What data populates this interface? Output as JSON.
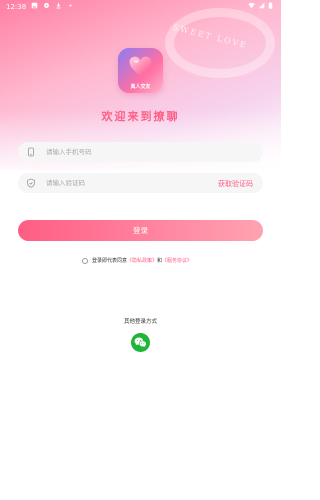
{
  "status_bar": {
    "time": "12:38",
    "left_icons": [
      "gallery-icon",
      "settings-icon",
      "download-icon",
      "dot-icon"
    ],
    "right_icons": [
      "wifi-icon",
      "signal-icon",
      "battery-icon"
    ]
  },
  "header": {
    "decor_text": "SWEET LOVE",
    "app_logo_label": "真人交友",
    "welcome": "欢迎来到撩聊"
  },
  "form": {
    "phone": {
      "placeholder": "请输入手机号码",
      "value": "",
      "icon": "phone-icon"
    },
    "code": {
      "placeholder": "请输入验证码",
      "value": "",
      "icon": "shield-icon",
      "get_code_label": "获取验证码"
    },
    "login_label": "登录"
  },
  "agreement": {
    "checked": false,
    "prefix": "登录即代表同意",
    "privacy_link": "《隐私政策》",
    "conjunction": "和",
    "service_link": "《服务协议》"
  },
  "other_login": {
    "label": "其他登录方式",
    "methods": [
      "wechat-icon"
    ]
  },
  "colors": {
    "accent": "#ff5e86",
    "wechat": "#1fb43a",
    "field_bg": "#f6f6f7"
  }
}
